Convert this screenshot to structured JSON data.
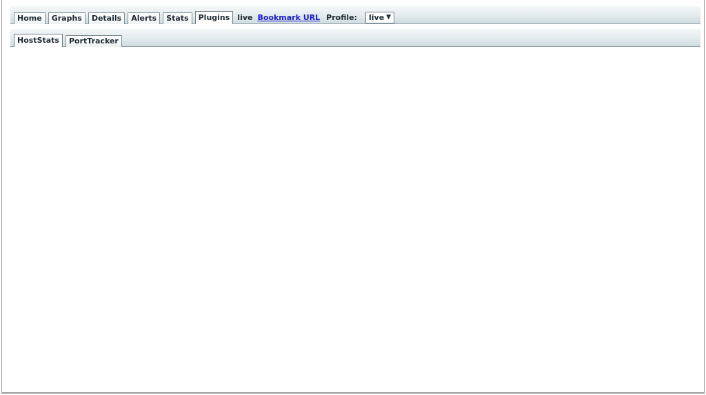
{
  "nav": {
    "tabs": [
      {
        "label": "Home"
      },
      {
        "label": "Graphs"
      },
      {
        "label": "Details"
      },
      {
        "label": "Alerts"
      },
      {
        "label": "Stats"
      },
      {
        "label": "Plugins"
      }
    ],
    "mode_label": "live",
    "bookmark_label": "Bookmark URL",
    "profile_label": "Profile:",
    "profile_value": "live",
    "dropdown_caret": "▼"
  },
  "subnav": {
    "tabs": [
      {
        "label": "HostStats"
      },
      {
        "label": "PortTracker"
      }
    ]
  }
}
